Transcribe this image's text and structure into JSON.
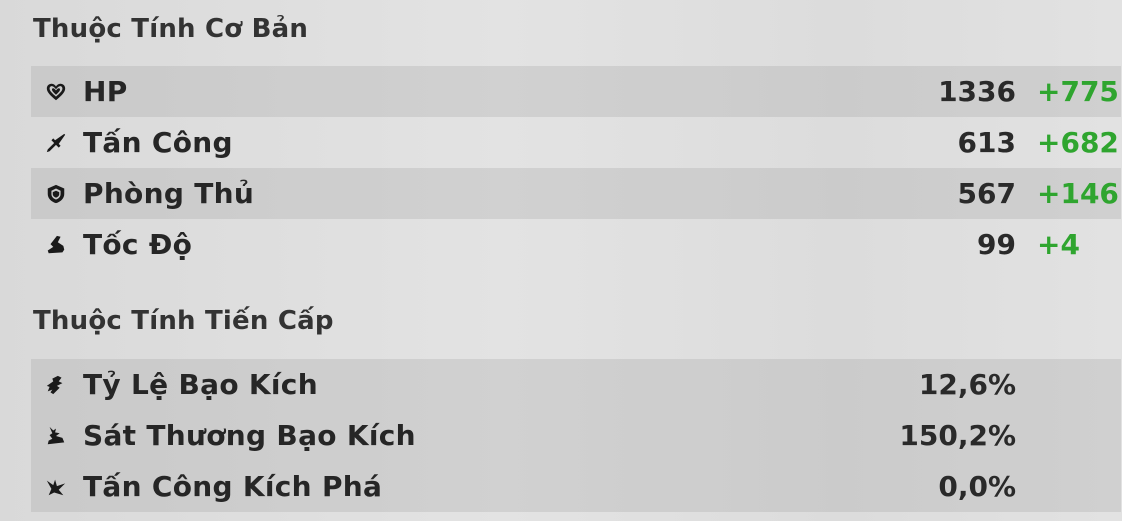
{
  "basic": {
    "title": "Thuộc Tính Cơ Bản",
    "stats": [
      {
        "icon": "heart-icon",
        "label": "HP",
        "value": "1336",
        "bonus": "+775"
      },
      {
        "icon": "sword-icon",
        "label": "Tấn Công",
        "value": "613",
        "bonus": "+682"
      },
      {
        "icon": "shield-icon",
        "label": "Phòng Thủ",
        "value": "567",
        "bonus": "+146"
      },
      {
        "icon": "boot-icon",
        "label": "Tốc Độ",
        "value": "99",
        "bonus": "+4"
      }
    ]
  },
  "advanced": {
    "title": "Thuộc Tính Tiến Cấp",
    "stats": [
      {
        "icon": "crit-rate-icon",
        "label": "Tỷ Lệ Bạo Kích",
        "value": "12,6%"
      },
      {
        "icon": "crit-damage-icon",
        "label": "Sát Thương Bạo Kích",
        "value": "150,2%"
      },
      {
        "icon": "break-effect-icon",
        "label": "Tấn Công Kích Phá",
        "value": "0,0%"
      }
    ]
  },
  "colors": {
    "bonus": "#2fa52f",
    "row_shade": "#c4c4c4",
    "text": "#262626"
  }
}
